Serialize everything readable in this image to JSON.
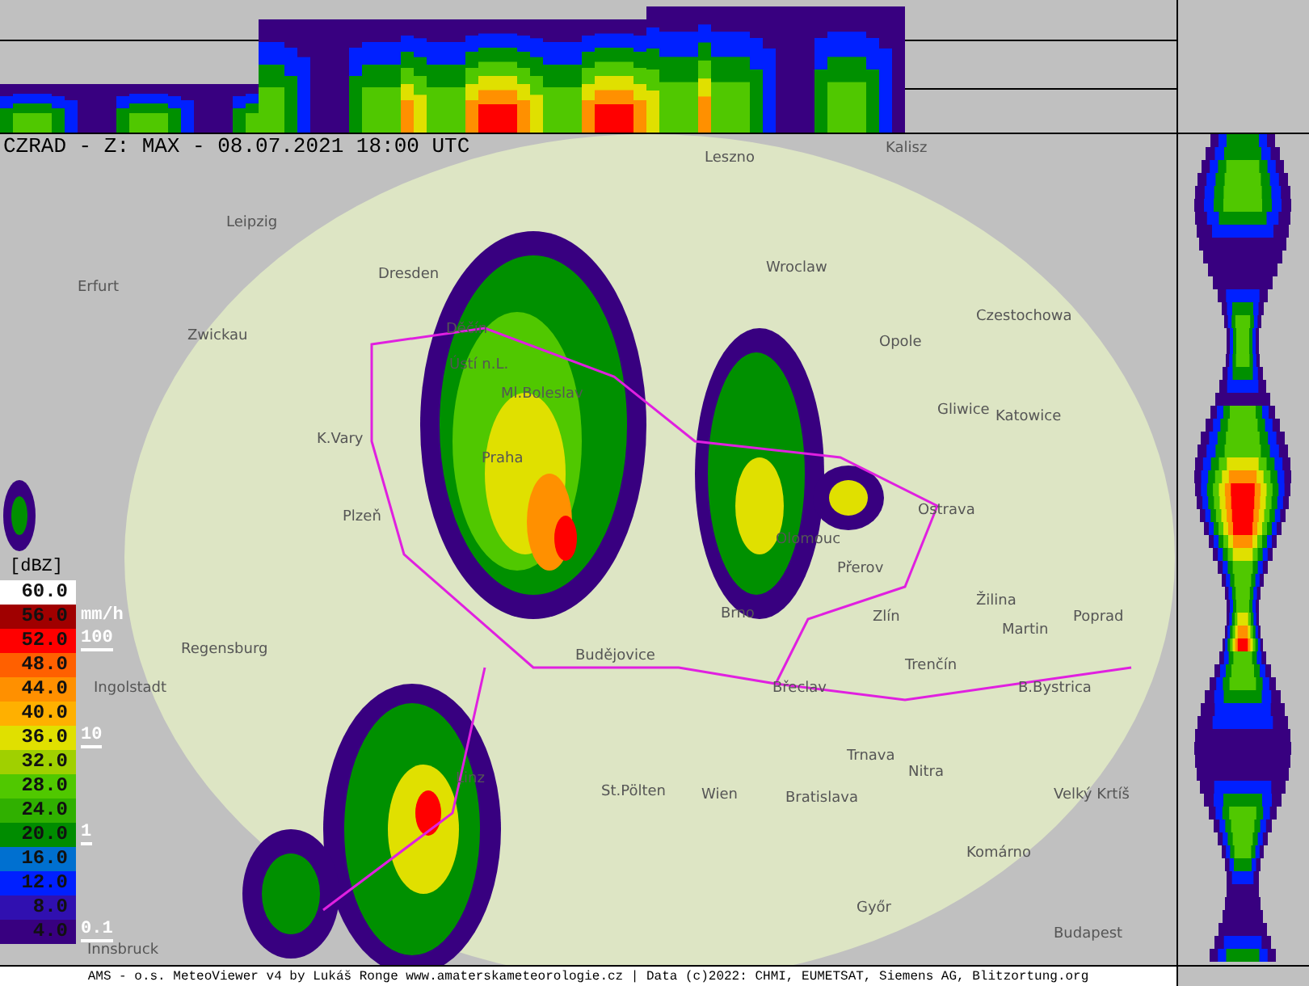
{
  "title": "CZRAD - Z: MAX - 08.07.2021 18:00 UTC",
  "cities": [
    "Leszno",
    "Kalisz",
    "Leipzig",
    "Erfurt",
    "Wroclaw",
    "Zwickau",
    "Dresden",
    "Czestochowa",
    "Opole",
    "Děčín",
    "Ústí n.L.",
    "Ml.Boleslav",
    "Gliwice",
    "Katowice",
    "K.Vary",
    "Praha",
    "Ostrava",
    "Plzeň",
    "Olomouc",
    "Přerov",
    "Žilina",
    "Martin",
    "Poprad",
    "Regensburg",
    "Brno",
    "Zlín",
    "Budějovice",
    "Trenčín",
    "Ingolstadt",
    "Břeclav",
    "B.Bystrica",
    "Trnava",
    "Linz",
    "St.Pölten",
    "Wien",
    "Bratislava",
    "Nitra",
    "Velký Krtíš",
    "Komárno",
    "Győr",
    "Budapest",
    "Innsbruck"
  ],
  "legend": {
    "unit": "[dBZ]",
    "rate_unit": "mm/h",
    "rates": [
      "100",
      "10",
      "1",
      "0.1"
    ],
    "levels": [
      {
        "value": "60.0",
        "color": "#ffffff"
      },
      {
        "value": "56.0",
        "color": "#a00000"
      },
      {
        "value": "52.0",
        "color": "#ff0000"
      },
      {
        "value": "48.0",
        "color": "#ff6000"
      },
      {
        "value": "44.0",
        "color": "#ff9000"
      },
      {
        "value": "40.0",
        "color": "#ffb000"
      },
      {
        "value": "36.0",
        "color": "#e0e000"
      },
      {
        "value": "32.0",
        "color": "#a0d000"
      },
      {
        "value": "28.0",
        "color": "#50c800"
      },
      {
        "value": "24.0",
        "color": "#30b000"
      },
      {
        "value": "20.0",
        "color": "#008c00"
      },
      {
        "value": "16.0",
        "color": "#0070d0"
      },
      {
        "value": "12.0",
        "color": "#0020ff"
      },
      {
        "value": "8.0",
        "color": "#3010b0"
      },
      {
        "value": "4.0",
        "color": "#380080"
      }
    ]
  },
  "footer": "AMS - o.s. MeteoViewer v4 by Lukáš Ronge www.amaterskameteorologie.cz | Data (c)2022: CHMI, EUMETSAT, Siemens AG, Blitzortung.org"
}
